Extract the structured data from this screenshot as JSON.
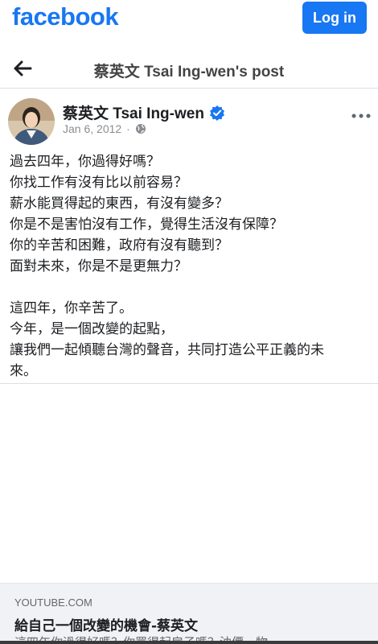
{
  "header": {
    "logo": "facebook",
    "login_label": "Log in"
  },
  "nav": {
    "back_icon": "arrow-left-icon",
    "title": "蔡英文 Tsai Ing-wen's post"
  },
  "post": {
    "author": "蔡英文 Tsai Ing-wen",
    "verified_icon": "verified-badge-icon",
    "date": "Jan 6, 2012",
    "separator": "·",
    "privacy_icon": "globe-icon",
    "more_icon": "more-options-icon",
    "paragraphs": [
      {
        "lines": [
          "過去四年，你過得好嗎？",
          "你找工作有沒有比以前容易？",
          "薪水能買得起的東西，有沒有變多？",
          "你是不是害怕沒有工作，覺得生活沒有保障？",
          "你的辛苦和困難，政府有沒有聽到？",
          "面對未來，你是不是更無力？"
        ]
      },
      {
        "lines": [
          "這四年，你辛苦了。",
          "今年，是一個改變的起點，",
          "讓我們一起傾聽台灣的聲音，共同打造公平正義的未",
          "來。"
        ]
      }
    ]
  },
  "link_card": {
    "domain": "YOUTUBE.COM",
    "title": "給自己一個改變的機會-蔡英文",
    "description": "這四年你過得好嗎？你買得起房子嗎？油價、物"
  },
  "colors": {
    "brand": "#1877f2",
    "text": "#1c1e21",
    "secondary": "#65676b"
  }
}
